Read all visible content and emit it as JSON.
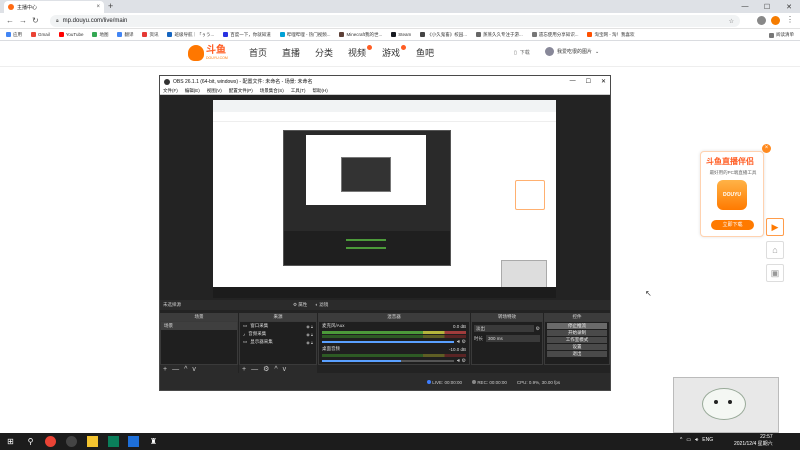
{
  "browser": {
    "tab_title": "主播中心",
    "tab_close": "×",
    "new_tab": "+",
    "window_controls": [
      "—",
      "☐",
      "✕"
    ],
    "url": "mp.douyu.com/live/main",
    "bookmarks": [
      {
        "label": "应用",
        "color": "#4285f4"
      },
      {
        "label": "Gmail",
        "color": "#ea4335"
      },
      {
        "label": "YouTube",
        "color": "#ff0000"
      },
      {
        "label": "地图",
        "color": "#34a853"
      },
      {
        "label": "翻译",
        "color": "#4285f4"
      },
      {
        "label": "资讯",
        "color": "#e53935"
      },
      {
        "label": "班级导航｜「ぅう...",
        "color": "#1565c0"
      },
      {
        "label": "百度一下，你就知道",
        "color": "#2932e1"
      },
      {
        "label": "哔哩哔哩 - 热门视频...",
        "color": "#00a1d6"
      },
      {
        "label": "Minecraft我的世...",
        "color": "#5d4037"
      },
      {
        "label": "Steam",
        "color": "#171a21"
      },
      {
        "label": "《小久鬼畜》校园...",
        "color": "#444"
      },
      {
        "label": "蒸蒸久久专注于游...",
        "color": "#666"
      },
      {
        "label": "遗忘使用分享知识...",
        "color": "#777"
      },
      {
        "label": "淘宝网 - 淘！我喜欢",
        "color": "#ff5000"
      }
    ],
    "reading_list": "阅读清单"
  },
  "douyu": {
    "logo_text": "斗鱼",
    "logo_sub": "DOUYU.COM",
    "nav": [
      "首页",
      "直播",
      "分类",
      "视频",
      "游戏",
      "鱼吧"
    ],
    "download": "下载",
    "username": "我爱吃很的图片"
  },
  "obs": {
    "title": "OBS 26.1.1 (64-bit, windows) - 配置文件: 未命名 - 场景: 未命名",
    "window_controls": [
      "—",
      "☐",
      "✕"
    ],
    "menu": [
      "文件(F)",
      "编辑(E)",
      "视图(V)",
      "配置文件(P)",
      "场景集合(S)",
      "工具(T)",
      "帮助(H)"
    ],
    "source_bar": {
      "left": "未选择源",
      "props": "属性",
      "filters": "滤镜"
    },
    "docks": {
      "scenes": {
        "title": "场景",
        "items": [
          "场景"
        ]
      },
      "sources": {
        "title": "来源",
        "items": [
          "窗口采集",
          "音频采集",
          "显示器采集"
        ]
      },
      "mixer": {
        "title": "混音器",
        "channels": [
          {
            "name": "麦克风/Aux",
            "db": "0.0 dB"
          },
          {
            "name": "桌面音频",
            "db": "-10.0 dB"
          }
        ]
      },
      "transitions": {
        "title": "转场特效",
        "type": "淡出",
        "duration_label": "时长",
        "duration": "300 ms"
      },
      "controls": {
        "title": "控件",
        "buttons": [
          "停止推流",
          "开始录制",
          "工作室模式",
          "设置",
          "退出"
        ]
      }
    },
    "footer_buttons": [
      "+",
      "—",
      "^",
      "v"
    ],
    "status": {
      "live": "LIVE: 00:00:00",
      "rec": "REC: 00:00:00",
      "cpu": "CPU: 0.9%, 30.00 fps"
    }
  },
  "promo": {
    "title": "斗鱼直播伴侣",
    "desc": "最好用的PC端直播工具",
    "app_label": "DOUYU",
    "button": "立即下载",
    "close": "×"
  },
  "taskbar": {
    "time": "22:57",
    "date": "2021/12/4 星期六",
    "lang": "ENG"
  }
}
